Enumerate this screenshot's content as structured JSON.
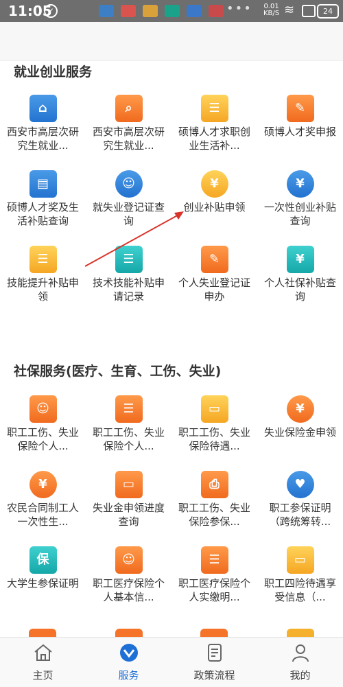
{
  "status_bar": {
    "time": "11:05",
    "net_speed_value": "0.01",
    "net_speed_unit": "KB/S",
    "battery": "24"
  },
  "sections": [
    {
      "title": "就业创业服务",
      "items": [
        {
          "label": "西安市高层次研究生就业...",
          "icon": "employment-register-icon",
          "color": "#2e7fd9"
        },
        {
          "label": "西安市高层次研究生就业...",
          "icon": "employment-query-icon",
          "color": "#f57c2a"
        },
        {
          "label": "硕博人才求职创业生活补...",
          "icon": "subsidy-apply-icon",
          "color": "#f5b02d"
        },
        {
          "label": "硕博人才奖申报",
          "icon": "award-apply-icon",
          "color": "#f5742a"
        },
        {
          "label": "硕博人才奖及生活补贴查询",
          "icon": "subsidy-query-icon",
          "color": "#2e7fd9"
        },
        {
          "label": "就失业登记证查询",
          "icon": "person-search-icon",
          "color": "#2e7fd9"
        },
        {
          "label": "创业补贴申领",
          "icon": "money-bag-icon",
          "color": "#f5b02d"
        },
        {
          "label": "一次性创业补贴查询",
          "icon": "money-bag-search-icon",
          "color": "#2e7fd9"
        },
        {
          "label": "技能提升补贴申领",
          "icon": "document-icon",
          "color": "#f5b02d"
        },
        {
          "label": "技术技能补贴申请记录",
          "icon": "document-record-icon",
          "color": "#1bb6b6"
        },
        {
          "label": "个人失业登记证申办",
          "icon": "form-edit-icon",
          "color": "#f5742a"
        },
        {
          "label": "个人社保补贴查询",
          "icon": "house-money-icon",
          "color": "#1bb6b6"
        }
      ]
    },
    {
      "title": "社保服务(医疗、生育、工伤、失业)",
      "items": [
        {
          "label": "职工工伤、失业保险个人...",
          "icon": "id-card-icon",
          "color": "#f5742a"
        },
        {
          "label": "职工工伤、失业保险个人...",
          "icon": "clipboard-icon",
          "color": "#f5742a"
        },
        {
          "label": "职工工伤、失业保险待遇...",
          "icon": "wallet-coins-icon",
          "color": "#f5b02d"
        },
        {
          "label": "失业保险金申领",
          "icon": "hand-money-icon",
          "color": "#f5742a"
        },
        {
          "label": "农民合同制工人一次性生...",
          "icon": "hand-money-icon",
          "color": "#f5742a"
        },
        {
          "label": "失业金申领进度查询",
          "icon": "wallet-icon",
          "color": "#f5742a"
        },
        {
          "label": "职工工伤、失业保险参保...",
          "icon": "printer-icon",
          "color": "#f5742a"
        },
        {
          "label": "职工参保证明（跨统筹转...",
          "icon": "heart-plus-icon",
          "color": "#2e7fd9"
        },
        {
          "label": "大学生参保证明",
          "icon": "shield-icon",
          "color": "#1bb6b6"
        },
        {
          "label": "职工医疗保险个人基本信...",
          "icon": "id-card-icon",
          "color": "#f5742a"
        },
        {
          "label": "职工医疗保险个人实缴明...",
          "icon": "clipboard-icon",
          "color": "#f5742a"
        },
        {
          "label": "职工四险待遇享受信息（...",
          "icon": "wallet-coins-icon",
          "color": "#f5b02d"
        }
      ]
    }
  ],
  "bottom_nav": [
    {
      "label": "主页",
      "icon": "home-icon",
      "active": false
    },
    {
      "label": "服务",
      "icon": "service-icon",
      "active": true
    },
    {
      "label": "政策流程",
      "icon": "policy-doc-icon",
      "active": false
    },
    {
      "label": "我的",
      "icon": "profile-icon",
      "active": false
    }
  ],
  "colors": {
    "accent": "#1e6fd6",
    "annotation_arrow": "#d9342b"
  }
}
